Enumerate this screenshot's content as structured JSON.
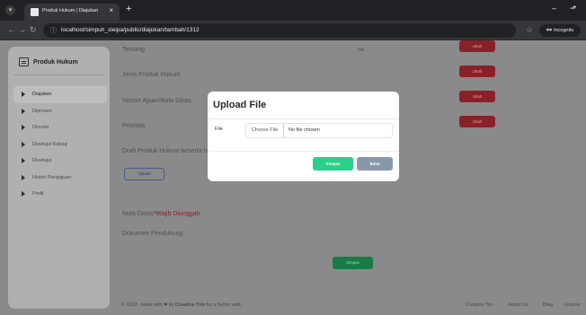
{
  "browser": {
    "tab_title": "Produk Hukum | Diajukan",
    "tab_close": "×",
    "new_tab": "+",
    "url": "localhost/simpuh_sleipa/public/diajukan/tambah/1312",
    "incognito_label": "Incognito",
    "minimize": "–",
    "pin": "⬏"
  },
  "sidebar": {
    "brand": "Produk Hukum",
    "items": [
      {
        "label": "Diajukan",
        "active": true
      },
      {
        "label": "Diproses",
        "active": false
      },
      {
        "label": "Direvisi",
        "active": false
      },
      {
        "label": "Disetujui Kabag",
        "active": false
      },
      {
        "label": "Disetujui",
        "active": false
      },
      {
        "label": "Histori Pengajuan",
        "active": false
      },
      {
        "label": "Profil",
        "active": false
      }
    ]
  },
  "main": {
    "tentang_label": "Tentang",
    "tentang_value": "tdk",
    "jenis_label": "Jenis Produk Hukum",
    "nomor_label": "Nomor Ajuan/Nota Dinas",
    "prioritas_label": "Prioritas",
    "ubah_label": "Ubah",
    "draft_label": "Draft Produk Hukum beserta lampiran",
    "wajib_label": "*Wajib Diunggah",
    "upload_label": "Upload",
    "nota_label": "Nota Dinas",
    "dokumen_label": "Dokumen Pendukung",
    "simpan_label": "Simpan"
  },
  "footer": {
    "prefix": "© 2023, made with",
    "by": "by",
    "author": "Creative Tim",
    "suffix": "for a better web.",
    "links": [
      "Creative Tim",
      "About Us",
      "Blog",
      "License"
    ]
  },
  "modal": {
    "title": "Upload File",
    "file_label": "File",
    "choose_label": "Choose File",
    "no_file": "No file chosen",
    "simpan": "Simpan",
    "batal": "Batal"
  },
  "colors": {
    "ubah_button": "#8a2028",
    "simpan": "#2dce89",
    "batal": "#8898aa",
    "required": "#8a1a24"
  }
}
